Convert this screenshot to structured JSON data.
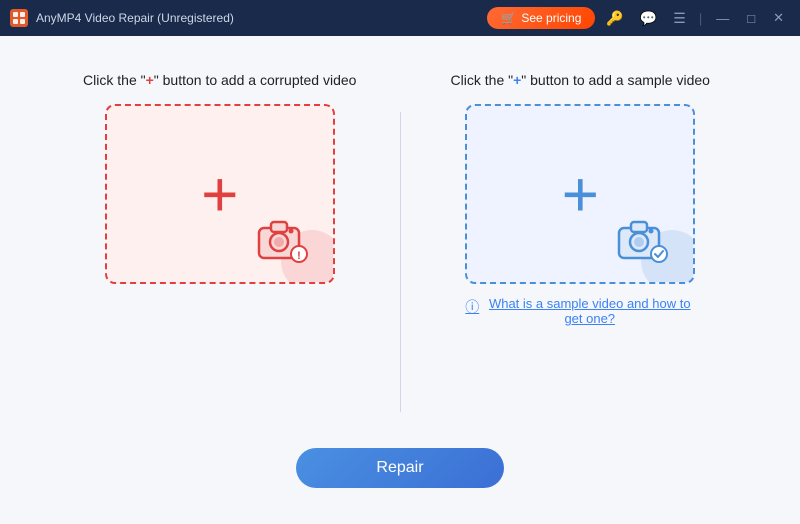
{
  "titlebar": {
    "app_name": "AnyMP4 Video Repair (Unregistered)",
    "pricing_btn": "See pricing",
    "win_minimize": "—",
    "win_maximize": "□",
    "win_close": "✕"
  },
  "left_panel": {
    "label_prefix": "Click the \"",
    "label_plus": "+",
    "label_suffix": "\" button to add a corrupted video",
    "plus_color": "red"
  },
  "right_panel": {
    "label_prefix": "Click the \"",
    "label_plus": "+",
    "label_suffix": "\" button to add a sample video",
    "plus_color": "blue",
    "help_text": "What is a sample video and how to get one?"
  },
  "repair_button": {
    "label": "Repair"
  }
}
